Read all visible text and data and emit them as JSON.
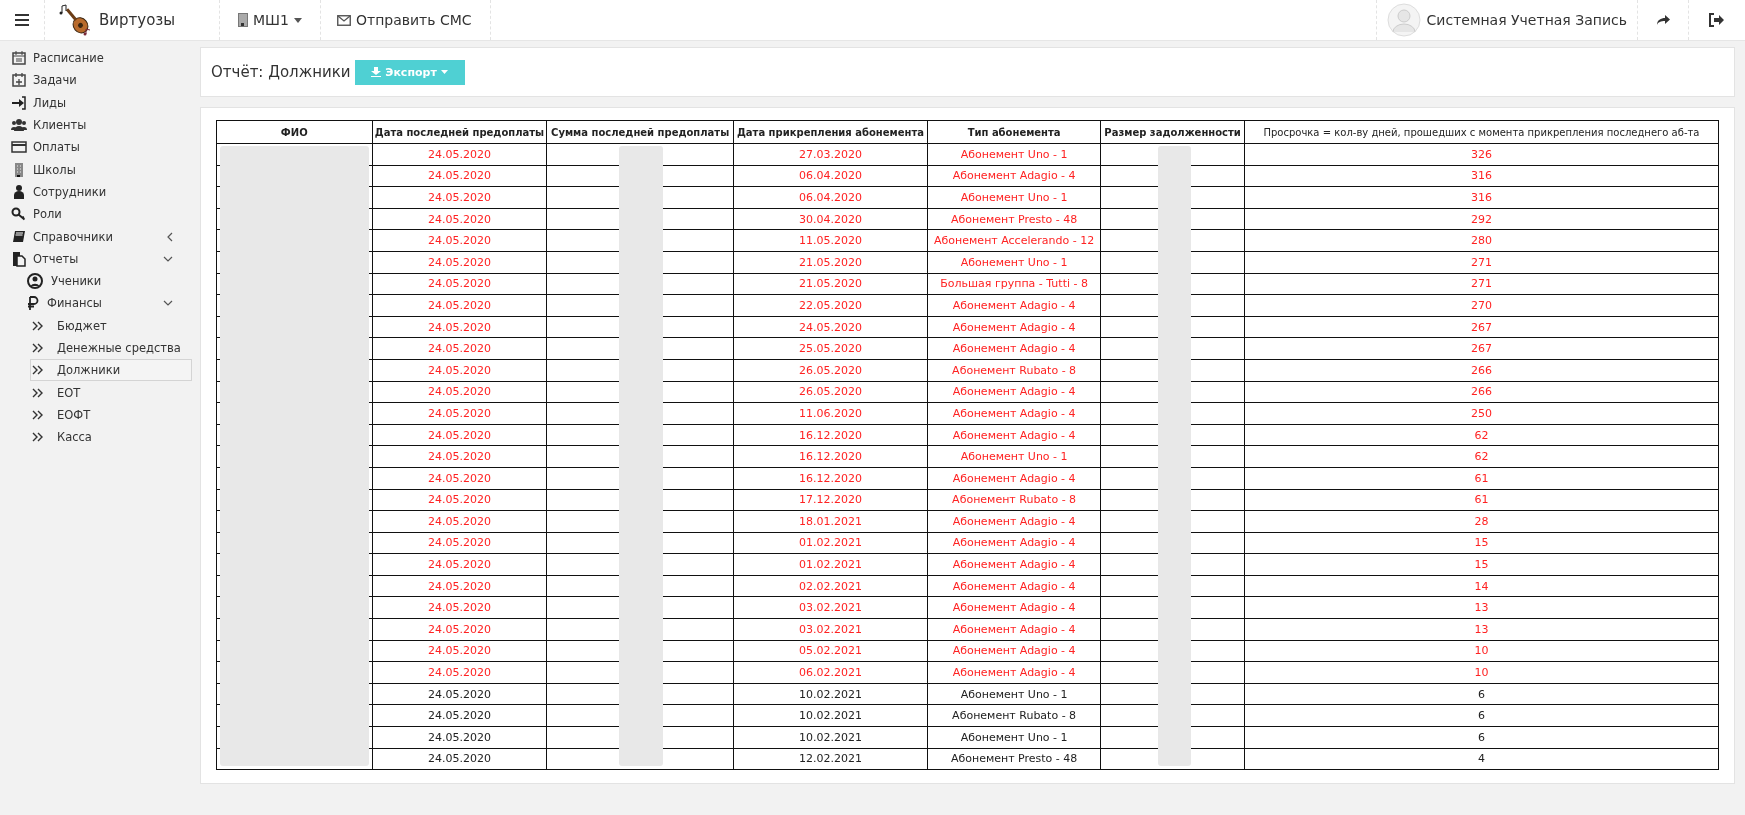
{
  "topbar": {
    "brand": "Виртуозы",
    "school": "МШ1",
    "sms": "Отправить СМС",
    "user": "Системная Учетная Запись"
  },
  "sidebar": {
    "items": [
      {
        "label": "Расписание"
      },
      {
        "label": "Задачи"
      },
      {
        "label": "Лиды"
      },
      {
        "label": "Клиенты"
      },
      {
        "label": "Оплаты"
      },
      {
        "label": "Школы"
      },
      {
        "label": "Сотрудники"
      },
      {
        "label": "Роли"
      },
      {
        "label": "Справочники",
        "expanded": false
      },
      {
        "label": "Отчеты",
        "expanded": true,
        "children": [
          {
            "label": "Ученики"
          },
          {
            "label": "Финансы",
            "expanded": true,
            "children": [
              {
                "label": "Бюджет",
                "selected": false
              },
              {
                "label": "Денежные средства",
                "selected": false
              },
              {
                "label": "Должники",
                "selected": true
              },
              {
                "label": "ЕОТ",
                "selected": false
              },
              {
                "label": "ЕОФТ",
                "selected": false
              },
              {
                "label": "Касса",
                "selected": false
              }
            ]
          }
        ]
      }
    ]
  },
  "report": {
    "title": "Отчёт: Должники",
    "export_button": "Экспорт"
  },
  "table": {
    "columns": [
      "ФИО",
      "Дата последней предоплаты",
      "Сумма последней предоплаты",
      "Дата прикрепления абонемента",
      "Тип абонемента",
      "Размер задолженности",
      "Просрочка = кол-ву дней, прошедших с момента прикрепления последнего аб-та"
    ],
    "rows": [
      {
        "prepay_date": "24.05.2020",
        "attach_date": "27.03.2020",
        "type": "Абонемент Uno - 1",
        "overdue_days": "326",
        "overdue": true
      },
      {
        "prepay_date": "24.05.2020",
        "attach_date": "06.04.2020",
        "type": "Абонемент Adagio - 4",
        "overdue_days": "316",
        "overdue": true
      },
      {
        "prepay_date": "24.05.2020",
        "attach_date": "06.04.2020",
        "type": "Абонемент Uno - 1",
        "overdue_days": "316",
        "overdue": true
      },
      {
        "prepay_date": "24.05.2020",
        "attach_date": "30.04.2020",
        "type": "Абонемент Presto - 48",
        "overdue_days": "292",
        "overdue": true
      },
      {
        "prepay_date": "24.05.2020",
        "attach_date": "11.05.2020",
        "type": "Абонемент Accelerando - 12",
        "overdue_days": "280",
        "overdue": true
      },
      {
        "prepay_date": "24.05.2020",
        "attach_date": "21.05.2020",
        "type": "Абонемент Uno - 1",
        "overdue_days": "271",
        "overdue": true
      },
      {
        "prepay_date": "24.05.2020",
        "attach_date": "21.05.2020",
        "type": "Большая группа - Tutti - 8",
        "overdue_days": "271",
        "overdue": true
      },
      {
        "prepay_date": "24.05.2020",
        "attach_date": "22.05.2020",
        "type": "Абонемент Adagio - 4",
        "overdue_days": "270",
        "overdue": true
      },
      {
        "prepay_date": "24.05.2020",
        "attach_date": "24.05.2020",
        "type": "Абонемент Adagio - 4",
        "overdue_days": "267",
        "overdue": true
      },
      {
        "prepay_date": "24.05.2020",
        "attach_date": "25.05.2020",
        "type": "Абонемент Adagio - 4",
        "overdue_days": "267",
        "overdue": true
      },
      {
        "prepay_date": "24.05.2020",
        "attach_date": "26.05.2020",
        "type": "Абонемент Rubato - 8",
        "overdue_days": "266",
        "overdue": true
      },
      {
        "prepay_date": "24.05.2020",
        "attach_date": "26.05.2020",
        "type": "Абонемент Adagio - 4",
        "overdue_days": "266",
        "overdue": true
      },
      {
        "prepay_date": "24.05.2020",
        "attach_date": "11.06.2020",
        "type": "Абонемент Adagio - 4",
        "overdue_days": "250",
        "overdue": true
      },
      {
        "prepay_date": "24.05.2020",
        "attach_date": "16.12.2020",
        "type": "Абонемент Adagio - 4",
        "overdue_days": "62",
        "overdue": true
      },
      {
        "prepay_date": "24.05.2020",
        "attach_date": "16.12.2020",
        "type": "Абонемент Uno - 1",
        "overdue_days": "62",
        "overdue": true
      },
      {
        "prepay_date": "24.05.2020",
        "attach_date": "16.12.2020",
        "type": "Абонемент Adagio - 4",
        "overdue_days": "61",
        "overdue": true
      },
      {
        "prepay_date": "24.05.2020",
        "attach_date": "17.12.2020",
        "type": "Абонемент Rubato - 8",
        "overdue_days": "61",
        "overdue": true
      },
      {
        "prepay_date": "24.05.2020",
        "attach_date": "18.01.2021",
        "type": "Абонемент Adagio - 4",
        "overdue_days": "28",
        "overdue": true
      },
      {
        "prepay_date": "24.05.2020",
        "attach_date": "01.02.2021",
        "type": "Абонемент Adagio - 4",
        "overdue_days": "15",
        "overdue": true
      },
      {
        "prepay_date": "24.05.2020",
        "attach_date": "01.02.2021",
        "type": "Абонемент Adagio - 4",
        "overdue_days": "15",
        "overdue": true
      },
      {
        "prepay_date": "24.05.2020",
        "attach_date": "02.02.2021",
        "type": "Абонемент Adagio - 4",
        "overdue_days": "14",
        "overdue": true
      },
      {
        "prepay_date": "24.05.2020",
        "attach_date": "03.02.2021",
        "type": "Абонемент Adagio - 4",
        "overdue_days": "13",
        "overdue": true
      },
      {
        "prepay_date": "24.05.2020",
        "attach_date": "03.02.2021",
        "type": "Абонемент Adagio - 4",
        "overdue_days": "13",
        "overdue": true
      },
      {
        "prepay_date": "24.05.2020",
        "attach_date": "05.02.2021",
        "type": "Абонемент Adagio - 4",
        "overdue_days": "10",
        "overdue": true
      },
      {
        "prepay_date": "24.05.2020",
        "attach_date": "06.02.2021",
        "type": "Абонемент Adagio - 4",
        "overdue_days": "10",
        "overdue": true
      },
      {
        "prepay_date": "24.05.2020",
        "attach_date": "10.02.2021",
        "type": "Абонемент Uno - 1",
        "overdue_days": "6",
        "overdue": false
      },
      {
        "prepay_date": "24.05.2020",
        "attach_date": "10.02.2021",
        "type": "Абонемент Rubato - 8",
        "overdue_days": "6",
        "overdue": false
      },
      {
        "prepay_date": "24.05.2020",
        "attach_date": "10.02.2021",
        "type": "Абонемент Uno - 1",
        "overdue_days": "6",
        "overdue": false
      },
      {
        "prepay_date": "24.05.2020",
        "attach_date": "12.02.2021",
        "type": "Абонемент Presto - 48",
        "overdue_days": "4",
        "overdue": false
      }
    ]
  }
}
